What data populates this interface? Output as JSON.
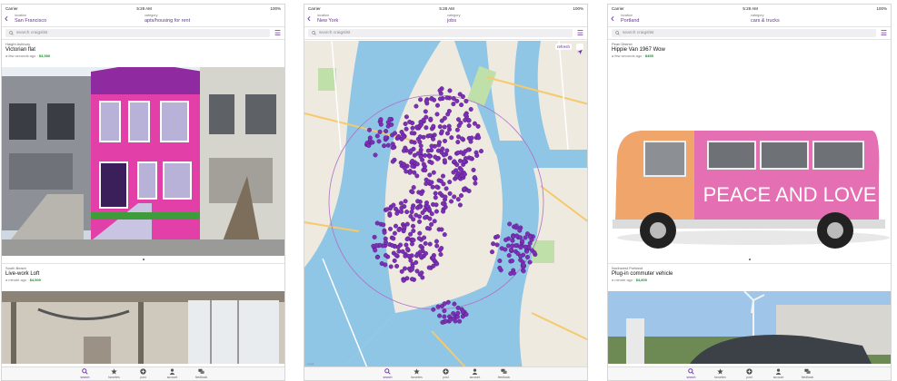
{
  "status_bar": {
    "carrier": "Carrier",
    "time": "5:28 AM",
    "battery": "100%"
  },
  "labels": {
    "location": "location",
    "category": "category"
  },
  "search_placeholder": "search craigslist",
  "tabs": [
    "search",
    "favorites",
    "post",
    "account",
    "feedback"
  ],
  "accent_color": "#6b2fa0",
  "price_color": "#1b8b2f",
  "screens": [
    {
      "location": "San Francisco",
      "category": "apts/housing for rent",
      "listings": [
        {
          "neighborhood": "Haight Ashbury",
          "title": "Victorian flat",
          "age": "a few seconds ago",
          "price": "$3,500"
        },
        {
          "neighborhood": "South Beach",
          "title": "Live-work Loft",
          "age": "a minute ago",
          "price": "$4,500"
        }
      ]
    },
    {
      "location": "New York",
      "category": "jobs",
      "map": {
        "refresh_label": "refresh",
        "legal": "Legal"
      }
    },
    {
      "location": "Portland",
      "category": "cars & trucks",
      "listings": [
        {
          "neighborhood": "Pearl District",
          "title": "Hippie Van 1967 Wow",
          "age": "a few seconds ago",
          "price": "$455"
        },
        {
          "neighborhood": "Northwest Portland",
          "title": "Plug-in commuter vehicle",
          "age": "a minute ago",
          "price": "$4,800"
        }
      ],
      "van_text": "PEACE AND LOVE"
    }
  ]
}
